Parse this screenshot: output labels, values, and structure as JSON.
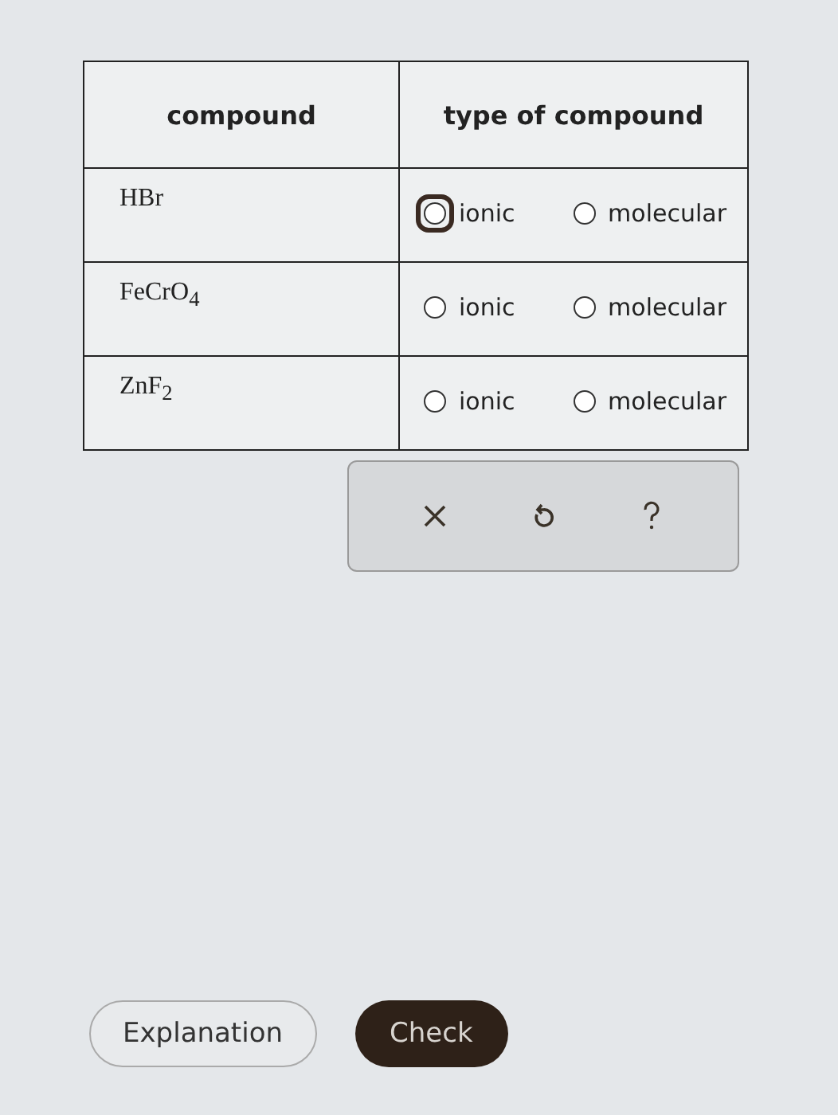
{
  "table": {
    "columns": [
      "compound",
      "type of compound"
    ],
    "rows": [
      {
        "compound": "HBr",
        "options": [
          {
            "label": "ionic",
            "selected": false,
            "focused": true
          },
          {
            "label": "molecular",
            "selected": false,
            "focused": false
          }
        ]
      },
      {
        "compound": "FeCrO$_{4}$",
        "options": [
          {
            "label": "ionic",
            "selected": false,
            "focused": false
          },
          {
            "label": "molecular",
            "selected": false,
            "focused": false
          }
        ]
      },
      {
        "compound": "ZnF$_{2}$",
        "options": [
          {
            "label": "ionic",
            "selected": false,
            "focused": false
          },
          {
            "label": "molecular",
            "selected": false,
            "focused": false
          }
        ]
      }
    ]
  },
  "buttons": [
    {
      "label": "Explanation",
      "kind": "secondary"
    },
    {
      "label": "Check",
      "kind": "primary"
    }
  ]
}
